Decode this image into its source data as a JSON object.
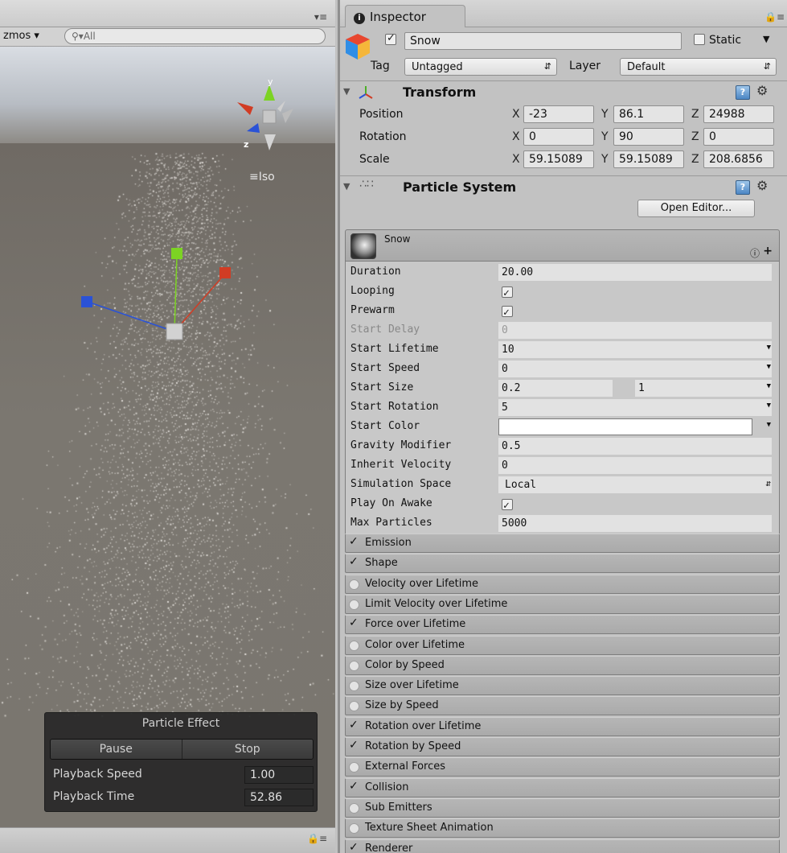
{
  "scene": {
    "gizmos_label": "zmos",
    "search_placeholder": "All",
    "iso_label": "Iso",
    "axis_y": "y",
    "axis_z": "z",
    "particle_effect": {
      "title": "Particle Effect",
      "pause_label": "Pause",
      "stop_label": "Stop",
      "playback_speed_label": "Playback Speed",
      "playback_speed_value": "1.00",
      "playback_time_label": "Playback Time",
      "playback_time_value": "52.86"
    }
  },
  "inspector": {
    "tab_label": "Inspector",
    "object_name": "Snow",
    "active": true,
    "static_label": "Static",
    "tag_label": "Tag",
    "tag_value": "Untagged",
    "layer_label": "Layer",
    "layer_value": "Default",
    "transform": {
      "title": "Transform",
      "position_label": "Position",
      "rotation_label": "Rotation",
      "scale_label": "Scale",
      "position": {
        "x": "-23",
        "y": "86.1",
        "z": "24988"
      },
      "rotation": {
        "x": "0",
        "y": "90",
        "z": "0"
      },
      "scale": {
        "x": "59.15089",
        "y": "59.15089",
        "z": "208.6856"
      },
      "axis_x": "X",
      "axis_y": "Y",
      "axis_z": "Z"
    },
    "particle_system": {
      "title": "Particle System",
      "open_editor_label": "Open Editor...",
      "system_name": "Snow",
      "properties": {
        "duration_label": "Duration",
        "duration": "20.00",
        "looping_label": "Looping",
        "prewarm_label": "Prewarm",
        "start_delay_label": "Start Delay",
        "start_delay": "0",
        "start_lifetime_label": "Start Lifetime",
        "start_lifetime": "10",
        "start_speed_label": "Start Speed",
        "start_speed": "0",
        "start_size_label": "Start Size",
        "start_size_min": "0.2",
        "start_size_max": "1",
        "start_rotation_label": "Start Rotation",
        "start_rotation": "5",
        "start_color_label": "Start Color",
        "start_color": "#ffffff",
        "gravity_modifier_label": "Gravity Modifier",
        "gravity_modifier": "0.5",
        "inherit_velocity_label": "Inherit Velocity",
        "inherit_velocity": "0",
        "simulation_space_label": "Simulation Space",
        "simulation_space": "Local",
        "play_on_awake_label": "Play On Awake",
        "max_particles_label": "Max Particles",
        "max_particles": "5000"
      },
      "modules": [
        {
          "label": "Emission",
          "enabled": true
        },
        {
          "label": "Shape",
          "enabled": true
        },
        {
          "label": "Velocity over Lifetime",
          "enabled": false
        },
        {
          "label": "Limit Velocity over Lifetime",
          "enabled": false
        },
        {
          "label": "Force over Lifetime",
          "enabled": true
        },
        {
          "label": "Color over Lifetime",
          "enabled": false
        },
        {
          "label": "Color by Speed",
          "enabled": false
        },
        {
          "label": "Size over Lifetime",
          "enabled": false
        },
        {
          "label": "Size by Speed",
          "enabled": false
        },
        {
          "label": "Rotation over Lifetime",
          "enabled": true
        },
        {
          "label": "Rotation by Speed",
          "enabled": true
        },
        {
          "label": "External Forces",
          "enabled": false
        },
        {
          "label": "Collision",
          "enabled": true
        },
        {
          "label": "Sub Emitters",
          "enabled": false
        },
        {
          "label": "Texture Sheet Animation",
          "enabled": false
        },
        {
          "label": "Renderer",
          "enabled": true
        }
      ]
    }
  },
  "colors": {
    "axis_x": "#d13c24",
    "axis_y": "#7cd323",
    "axis_z": "#2a52d6"
  }
}
